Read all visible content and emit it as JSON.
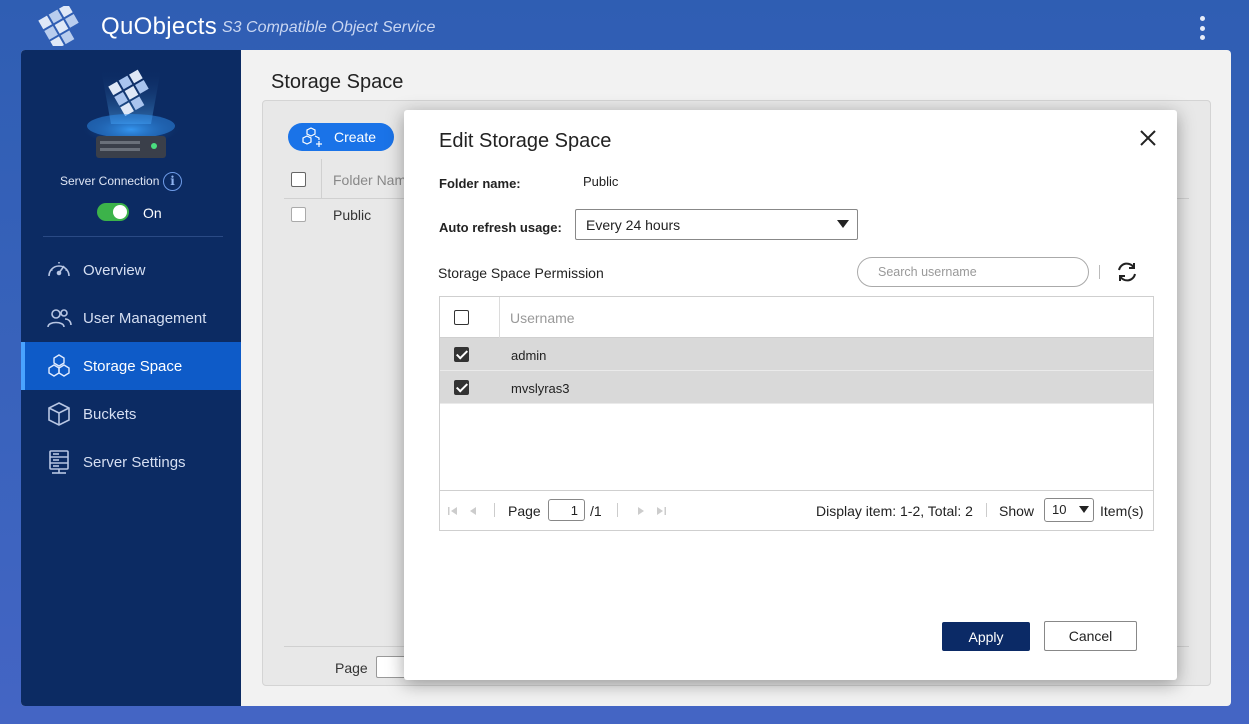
{
  "header": {
    "title": "QuObjects",
    "subtitle": "S3 Compatible Object Service"
  },
  "sidebar": {
    "server_connection_label": "Server Connection",
    "toggle_state": "On",
    "items": [
      {
        "label": "Overview",
        "icon": "speedometer-icon"
      },
      {
        "label": "User Management",
        "icon": "users-icon"
      },
      {
        "label": "Storage Space",
        "icon": "cubes-icon",
        "active": true
      },
      {
        "label": "Buckets",
        "icon": "cube-icon"
      },
      {
        "label": "Server Settings",
        "icon": "server-icon"
      }
    ]
  },
  "content": {
    "title": "Storage Space",
    "create_label": "Create",
    "column_folder_name": "Folder Nam",
    "rows": [
      "Public"
    ],
    "footer_page_label": "Page"
  },
  "modal": {
    "title": "Edit Storage Space",
    "folder_name_label": "Folder name:",
    "folder_name_value": "Public",
    "auto_refresh_label": "Auto refresh usage:",
    "auto_refresh_value": "Every 24 hours",
    "permission_label": "Storage Space Permission",
    "search_placeholder": "Search username",
    "column_username": "Username",
    "users": [
      {
        "name": "admin",
        "checked": true
      },
      {
        "name": "mvslyras3",
        "checked": true
      }
    ],
    "pagination": {
      "page_label": "Page",
      "current_page": "1",
      "total_pages": "/1",
      "display_info": "Display item: 1-2, Total: 2",
      "show_label": "Show",
      "per_page": "10",
      "items_label": "Item(s)"
    },
    "apply_label": "Apply",
    "cancel_label": "Cancel"
  },
  "colors": {
    "accent": "#1a73e8",
    "sidebar_bg": "#0c2b63",
    "active_nav": "#0e5bc8",
    "apply_button": "#0b2a66",
    "toggle_on": "#3cb34a"
  }
}
